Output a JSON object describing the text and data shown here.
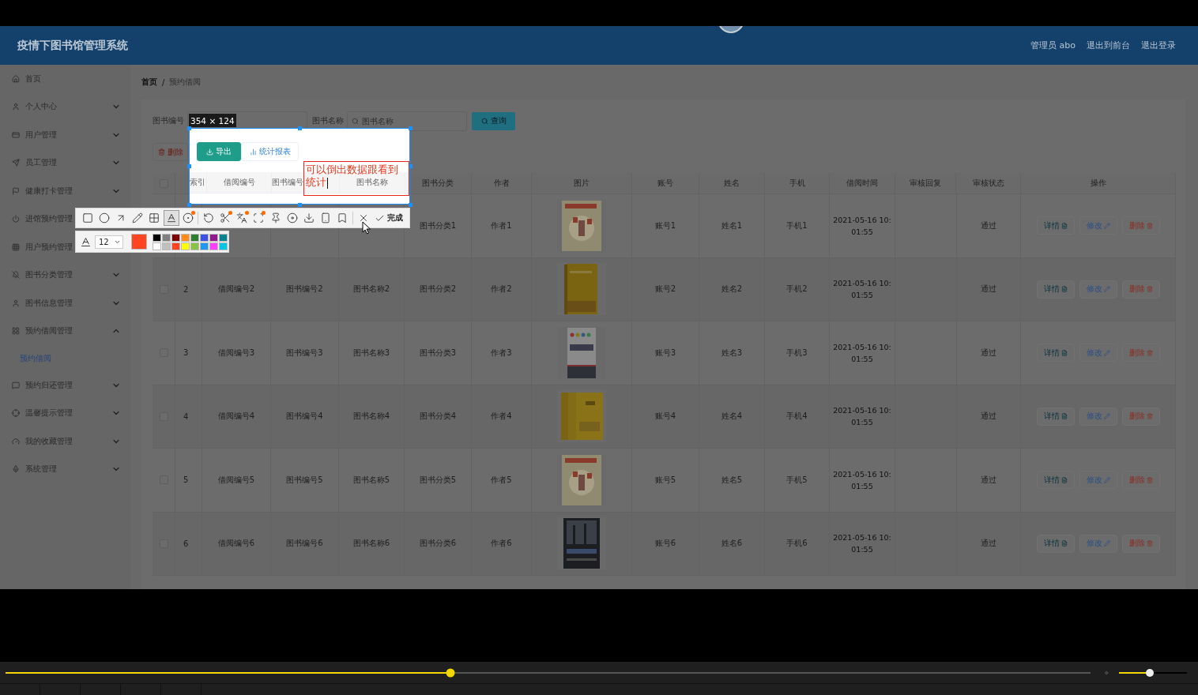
{
  "app": {
    "title": "疫情下图书馆管理系统",
    "header_links": [
      "管理员 abo",
      "退出到前台",
      "退出登录"
    ],
    "sidebar": [
      {
        "label": "首页"
      },
      {
        "label": "个人中心",
        "expanded": false
      },
      {
        "label": "用户管理",
        "expanded": false
      },
      {
        "label": "员工管理",
        "expanded": false
      },
      {
        "label": "健康打卡管理",
        "expanded": false
      },
      {
        "label": "进馆预约管理"
      },
      {
        "label": "用户预约管理"
      },
      {
        "label": "图书分类管理",
        "expanded": false
      },
      {
        "label": "图书信息管理",
        "expanded": false
      },
      {
        "label": "预约借阅管理",
        "expanded": true,
        "children": [
          {
            "label": "预约借阅",
            "selected": true
          }
        ]
      },
      {
        "label": "预约归还管理",
        "expanded": false
      },
      {
        "label": "温馨提示管理",
        "expanded": false
      },
      {
        "label": "我的收藏管理",
        "expanded": false
      },
      {
        "label": "系统管理",
        "expanded": false
      }
    ],
    "breadcrumb": [
      "首页",
      "预约借阅"
    ],
    "breadcrumb_separator": "/",
    "search": {
      "fields": [
        {
          "label": "图书编号"
        },
        {
          "label": "图书名称",
          "placeholder": "图书名称"
        }
      ],
      "button": "查询"
    },
    "actions": [
      "删除"
    ],
    "table": {
      "all_checked": false,
      "columns": [
        "图书分类",
        "作者",
        "图片",
        "账号",
        "姓名",
        "手机",
        "借阅时间",
        "审核回复",
        "审核状态",
        "操作"
      ],
      "rows": [
        {
          "category": "图书分类1",
          "author": "作者1",
          "image": {
            "kind": "picture"
          },
          "account": "账号1",
          "name": "姓名1",
          "phone": "手机1",
          "time": "2021-05-16 10:01:55",
          "status": "通过",
          "actions": [
            {
              "kind": "detail",
              "label": "详情"
            },
            {
              "kind": "edit",
              "label": "修改"
            },
            {
              "kind": "delete",
              "label": "删除"
            }
          ]
        },
        {
          "checked": false,
          "index": "2",
          "borrow_no": "借阅编号2",
          "book_no": "图书编号2",
          "book_name": "图书名称2",
          "category": "图书分类2",
          "author": "作者2",
          "image": {
            "kind": "picture"
          },
          "account": "账号2",
          "name": "姓名2",
          "phone": "手机2",
          "time": "2021-05-16 10:01:55",
          "status": "通过",
          "actions": [
            {
              "kind": "detail",
              "label": "详情"
            },
            {
              "kind": "edit",
              "label": "修改"
            },
            {
              "kind": "delete",
              "label": "删除"
            }
          ]
        },
        {
          "checked": false,
          "index": "3",
          "borrow_no": "借阅编号3",
          "book_no": "图书编号3",
          "book_name": "图书名称3",
          "category": "图书分类3",
          "author": "作者3",
          "image": {
            "kind": "picture"
          },
          "account": "账号3",
          "name": "姓名3",
          "phone": "手机3",
          "time": "2021-05-16 10:01:55",
          "status": "通过",
          "actions": [
            {
              "kind": "detail",
              "label": "详情"
            },
            {
              "kind": "edit",
              "label": "修改"
            },
            {
              "kind": "delete",
              "label": "删除"
            }
          ]
        },
        {
          "checked": false,
          "index": "4",
          "borrow_no": "借阅编号4",
          "book_no": "图书编号4",
          "book_name": "图书名称4",
          "category": "图书分类4",
          "author": "作者4",
          "image": {
            "kind": "picture"
          },
          "account": "账号4",
          "name": "姓名4",
          "phone": "手机4",
          "time": "2021-05-16 10:01:55",
          "status": "通过",
          "actions": [
            {
              "kind": "detail",
              "label": "详情"
            },
            {
              "kind": "edit",
              "label": "修改"
            },
            {
              "kind": "delete",
              "label": "删除"
            }
          ]
        },
        {
          "checked": false,
          "index": "5",
          "borrow_no": "借阅编号5",
          "book_no": "图书编号5",
          "book_name": "图书名称5",
          "category": "图书分类5",
          "author": "作者5",
          "image": {
            "kind": "picture"
          },
          "account": "账号5",
          "name": "姓名5",
          "phone": "手机5",
          "time": "2021-05-16 10:01:55",
          "status": "通过",
          "actions": [
            {
              "kind": "detail",
              "label": "详情"
            },
            {
              "kind": "edit",
              "label": "修改"
            },
            {
              "kind": "delete",
              "label": "删除"
            }
          ]
        },
        {
          "checked": false,
          "index": "6",
          "borrow_no": "借阅编号6",
          "book_no": "图书编号6",
          "book_name": "图书名称6",
          "category": "图书分类6",
          "author": "作者6",
          "image": {
            "kind": "picture"
          },
          "account": "账号6",
          "name": "姓名6",
          "phone": "手机6",
          "time": "2021-05-16 10:01:55",
          "status": "通过",
          "actions": [
            {
              "kind": "detail",
              "label": "详情"
            },
            {
              "kind": "edit",
              "label": "修改"
            },
            {
              "kind": "delete",
              "label": "删除"
            }
          ]
        }
      ]
    }
  },
  "capture": {
    "size": "354 × 124",
    "buttons": [
      "导出",
      "统计报表"
    ],
    "columns": [
      "索引",
      "借阅编号",
      "图书编号",
      "图书名称"
    ],
    "note": "可以倒出数据跟看到统计"
  },
  "toolbar": {
    "tools": [
      {
        "selected": false,
        "dot": false
      },
      {
        "selected": false,
        "dot": false
      },
      {
        "selected": false,
        "dot": false
      },
      {
        "selected": false,
        "dot": false
      },
      {
        "selected": false,
        "dot": false
      },
      {
        "selected": true,
        "dot": false
      },
      {
        "selected": false,
        "dot": true
      },
      {
        "selected": false,
        "dot": false
      },
      {
        "selected": false,
        "dot": true
      },
      {
        "selected": false,
        "dot": true
      },
      {
        "selected": false,
        "dot": true
      },
      {
        "selected": false,
        "dot": false
      },
      {
        "selected": false,
        "dot": false
      },
      {
        "selected": false,
        "dot": false
      },
      {
        "selected": false,
        "dot": false
      },
      {
        "selected": false,
        "dot": false
      },
      {
        "selected": false,
        "dot": false
      }
    ],
    "done": "完成"
  },
  "palette": {
    "font_size": "12",
    "current": {
      "color": "#ff4422"
    },
    "swatches": [
      {
        "color": "#000000"
      },
      {
        "color": "#808080"
      },
      {
        "color": "#800000"
      },
      {
        "color": "#ff8c1a"
      },
      {
        "color": "#2e7d32"
      },
      {
        "color": "#3f51e5"
      },
      {
        "color": "#8e1a8e"
      },
      {
        "color": "#00838f"
      },
      {
        "color": "#ffffff"
      },
      {
        "color": "#c0c0c0"
      },
      {
        "color": "#ff4422"
      },
      {
        "color": "#ffff00"
      },
      {
        "color": "#8bc34a"
      },
      {
        "color": "#2196f3"
      },
      {
        "color": "#ff40ff"
      },
      {
        "color": "#00c8e0"
      }
    ]
  },
  "player": {
    "progress": {
      "level": 0.41
    },
    "volume": {
      "level": 0.45
    }
  }
}
